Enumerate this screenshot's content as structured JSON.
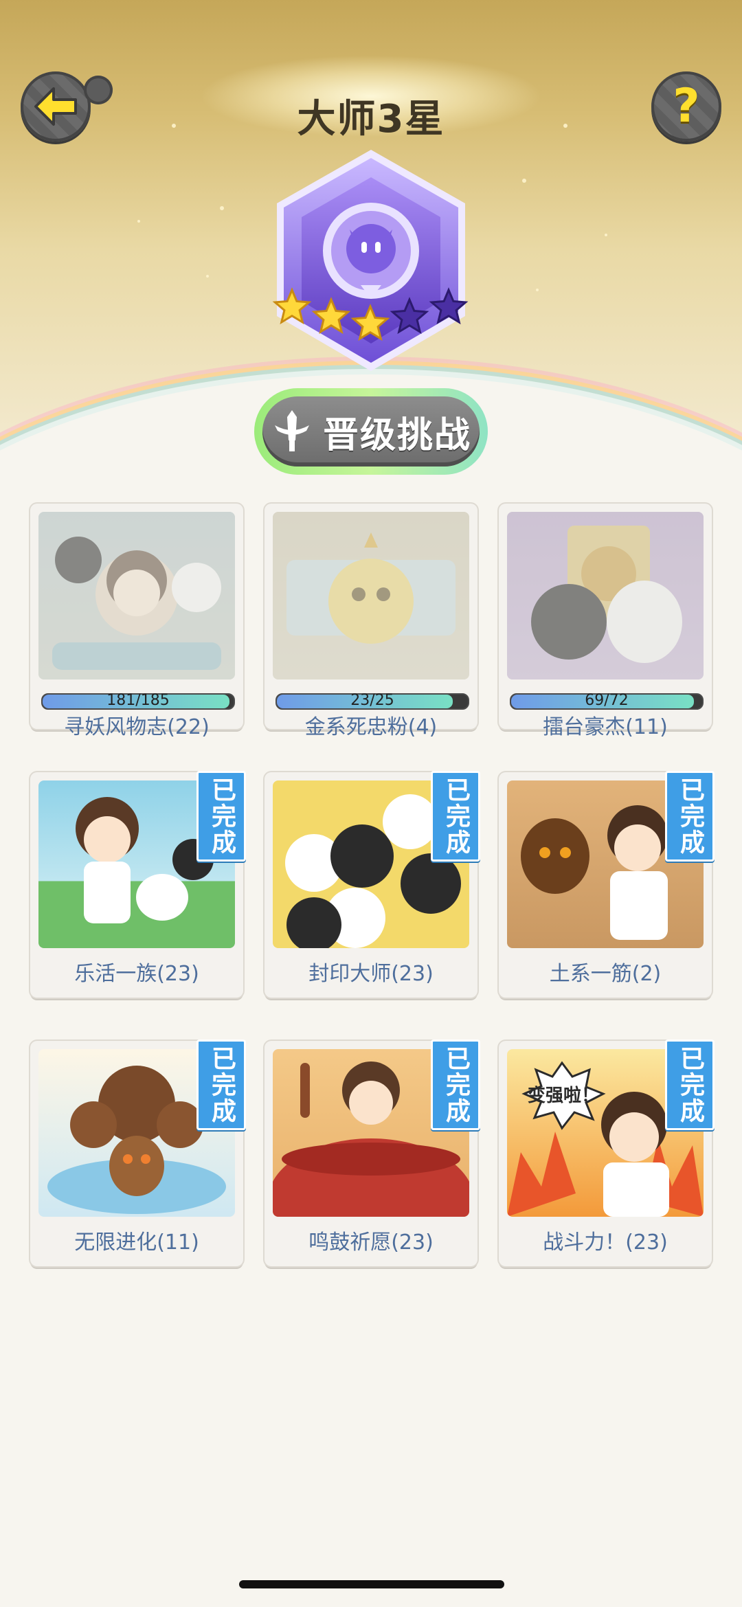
{
  "header": {
    "rank_title": "大师3星",
    "stars_filled": 3,
    "stars_total": 5,
    "challenge_label": "晋级挑战"
  },
  "icons": {
    "back": "back-arrow-icon",
    "help": "question-mark-icon",
    "challenge": "sword-icon"
  },
  "colors": {
    "accent_gold": "#d7bd74",
    "badge_purple": "#8b6fe0",
    "done_blue": "#3f9ee6",
    "label_blue": "#4e6e9c"
  },
  "achievements": [
    {
      "label": "寻妖风物志(22)",
      "status": "in-progress",
      "progress": "181/185",
      "progress_value": 181,
      "progress_max": 185
    },
    {
      "label": "金系死忠粉(4)",
      "status": "in-progress",
      "progress": "23/25",
      "progress_value": 23,
      "progress_max": 25
    },
    {
      "label": "擂台豪杰(11)",
      "status": "in-progress",
      "progress": "69/72",
      "progress_value": 69,
      "progress_max": 72
    },
    {
      "label": "乐活一族(23)",
      "status": "done",
      "badge": "已完成"
    },
    {
      "label": "封印大师(23)",
      "status": "done",
      "badge": "已完成"
    },
    {
      "label": "土系一筋(2)",
      "status": "done",
      "badge": "已完成"
    },
    {
      "label": "无限进化(11)",
      "status": "done",
      "badge": "已完成"
    },
    {
      "label": "鸣鼓祈愿(23)",
      "status": "done",
      "badge": "已完成"
    },
    {
      "label": "战斗力！(23)",
      "status": "done",
      "badge": "已完成",
      "art_text": "变强啦！"
    }
  ]
}
